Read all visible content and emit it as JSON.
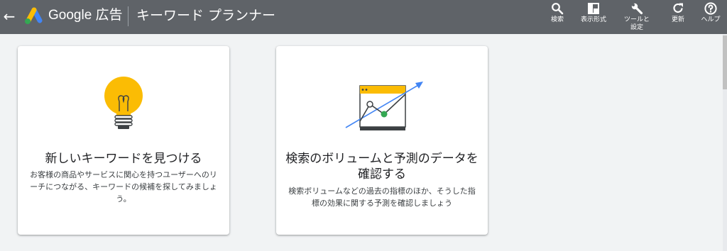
{
  "header": {
    "back_symbol": "←",
    "brand": "Google 広告",
    "tool_title": "キーワード プランナー",
    "actions": [
      {
        "label": "検索",
        "icon": "search-icon"
      },
      {
        "label": "表示形式",
        "icon": "display-format-icon"
      },
      {
        "label": "ツールと設定",
        "icon": "wrench-icon"
      },
      {
        "label": "更新",
        "icon": "refresh-icon"
      },
      {
        "label": "ヘルプ",
        "icon": "help-icon"
      }
    ]
  },
  "cards": [
    {
      "title": "新しいキーワードを見つける",
      "description": "お客様の商品やサービスに関心を持つユーザーへのリーチにつながる、キーワードの候補を探してみましょう。",
      "illustration": "lightbulb-icon"
    },
    {
      "title": "検索のボリュームと予測のデータを確認する",
      "description": "検索ボリュームなどの過去の指標のほか、そうした指標の効果に関する予測を確認しましょう",
      "illustration": "trend-chart-icon"
    }
  ],
  "colors": {
    "topbar": "#5f6368",
    "background": "#f1f3f4",
    "bulb": "#fbbc04",
    "arrow": "#4285f4",
    "point": "#34a853"
  }
}
